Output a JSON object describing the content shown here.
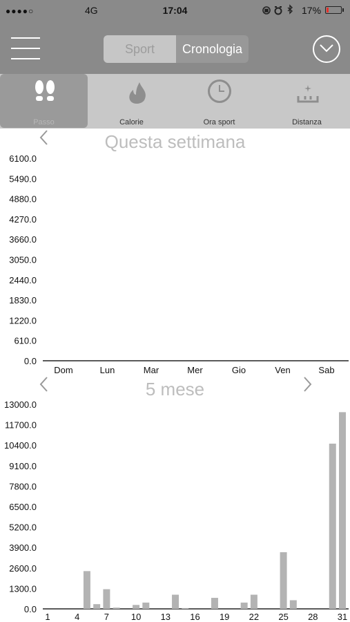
{
  "status_bar": {
    "signal": "●●●●○",
    "network": "4G",
    "time": "17:04",
    "battery_percent": "17%",
    "battery_level": 0.17,
    "battery_color": "#e8312a"
  },
  "nav": {
    "segments": [
      {
        "label": "Sport",
        "active": false
      },
      {
        "label": "Cronologia",
        "active": true
      }
    ]
  },
  "tabs": [
    {
      "label": "Passo",
      "icon": "footsteps-icon",
      "selected": true
    },
    {
      "label": "Calorie",
      "icon": "flame-icon",
      "selected": false
    },
    {
      "label": "Ora sport",
      "icon": "clock-icon",
      "selected": false
    },
    {
      "label": "Distanza",
      "icon": "distance-icon",
      "selected": false
    }
  ],
  "weekly": {
    "title": "Questa settimana"
  },
  "monthly": {
    "title": "5 mese"
  },
  "chart_data": [
    {
      "type": "bar",
      "title": "Questa settimana",
      "categories": [
        "Dom",
        "Lun",
        "Mar",
        "Mer",
        "Gio",
        "Ven",
        "Sab"
      ],
      "values": [
        0,
        0,
        0,
        0,
        0,
        0,
        0
      ],
      "y_ticks": [
        "0.0",
        "610.0",
        "1220.0",
        "1830.0",
        "2440.0",
        "3050.0",
        "3660.0",
        "4270.0",
        "4880.0",
        "5490.0",
        "6100.0"
      ],
      "ylim": [
        0,
        6100
      ],
      "grid": false
    },
    {
      "type": "bar",
      "title": "5 mese",
      "x": [
        1,
        2,
        3,
        4,
        5,
        6,
        7,
        8,
        9,
        10,
        11,
        12,
        13,
        14,
        15,
        16,
        17,
        18,
        19,
        20,
        21,
        22,
        23,
        24,
        25,
        26,
        27,
        28,
        29,
        30,
        31
      ],
      "x_tick_labels": [
        "1",
        "4",
        "7",
        "10",
        "13",
        "16",
        "19",
        "22",
        "25",
        "28",
        "31"
      ],
      "x_tick_values": [
        1,
        4,
        7,
        10,
        13,
        16,
        19,
        22,
        25,
        28,
        31
      ],
      "values": [
        0,
        0,
        0,
        0,
        2400,
        300,
        1250,
        80,
        0,
        250,
        400,
        0,
        0,
        900,
        50,
        0,
        0,
        700,
        0,
        0,
        400,
        900,
        0,
        0,
        3600,
        550,
        0,
        0,
        0,
        10500,
        12500
      ],
      "y_ticks": [
        "0.0",
        "1300.0",
        "2600.0",
        "3900.0",
        "5200.0",
        "6500.0",
        "7800.0",
        "9100.0",
        "10400.0",
        "11700.0",
        "13000.0"
      ],
      "ylim": [
        0,
        13000
      ],
      "bar_color": "#b3b3b3",
      "grid": false
    }
  ]
}
